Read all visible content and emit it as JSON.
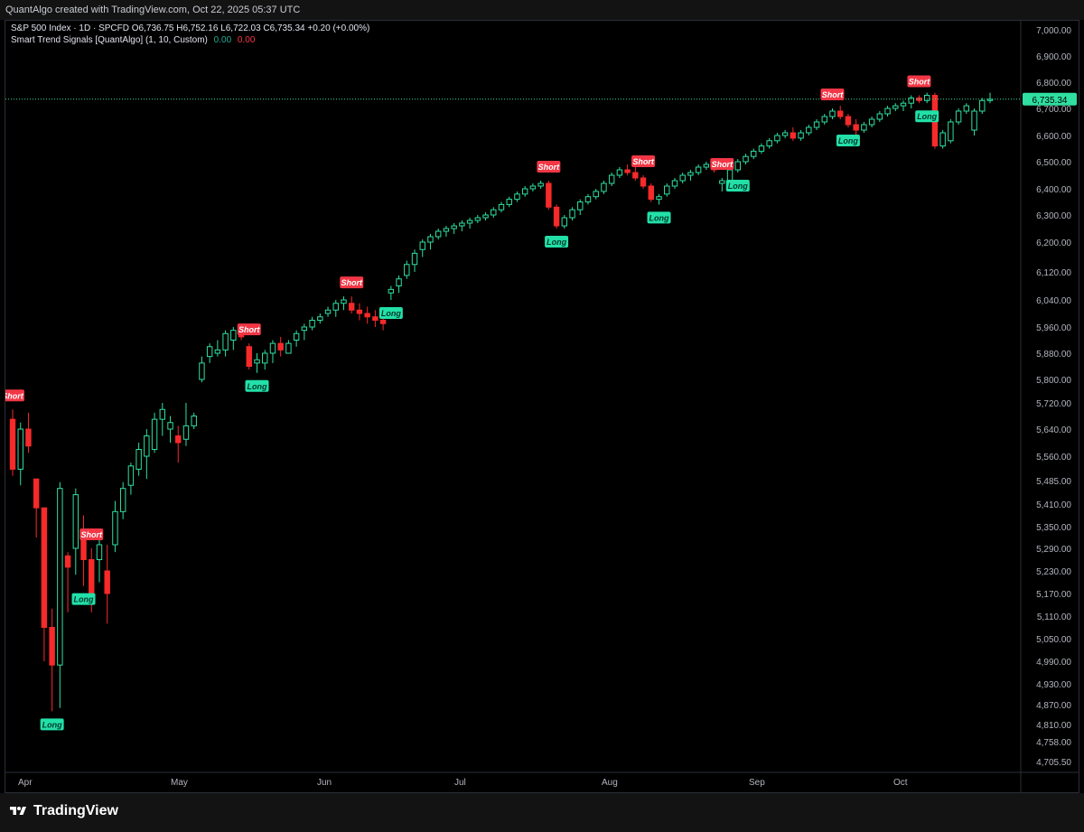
{
  "header": {
    "credit": "QuantAlgo created with TradingView.com, Oct 22, 2025 05:37 UTC"
  },
  "legend": {
    "symbol_line": "S&P 500 Index · 1D · SPCFD  O6,736.75  H6,752.16  L6,722.03  C6,735.34  +0.20 (+0.00%)",
    "indicator_name": "Smart Trend Signals [QuantAlgo] (1, 10, Custom)",
    "indicator_val1": "0.00",
    "indicator_val2": "0.00"
  },
  "footer": {
    "brand": "TradingView"
  },
  "colors": {
    "up": "#2fe0a0",
    "down": "#f72a2a",
    "short_label_bg": "#f23645",
    "long_label_bg": "#22e0a8",
    "grid": "#1e222d",
    "axis_text": "#b2b5be"
  },
  "chart_data": {
    "type": "candlestick",
    "title": "",
    "price_axis_ticks": [
      "7,000.00",
      "6,900.00",
      "6,800.00",
      "6,700.00",
      "6,600.00",
      "6,500.00",
      "6,400.00",
      "6,300.00",
      "6,200.00",
      "6,120.00",
      "6,040.00",
      "5,960.00",
      "5,880.00",
      "5,800.00",
      "5,720.00",
      "5,640.00",
      "5,560.00",
      "5,485.00",
      "5,410.00",
      "5,350.00",
      "5,290.00",
      "5,230.00",
      "5,170.00",
      "5,110.00",
      "5,050.00",
      "4,990.00",
      "4,930.00",
      "4,870.00",
      "4,810.00",
      "4,758.00",
      "4,705.50"
    ],
    "current_price_label": "6,735.34",
    "current_price": 6735.34,
    "time_axis_ticks": [
      "Apr",
      "May",
      "Jun",
      "Jul",
      "Aug",
      "Sep",
      "Oct"
    ],
    "candles": [
      [
        5670,
        5700,
        5500,
        5520
      ],
      [
        5520,
        5660,
        5470,
        5640
      ],
      [
        5640,
        5690,
        5570,
        5590
      ],
      [
        5490,
        5490,
        5320,
        5400
      ],
      [
        5400,
        5400,
        4990,
        5080
      ],
      [
        5080,
        5130,
        4850,
        4980
      ],
      [
        4980,
        5480,
        4860,
        5460
      ],
      [
        5270,
        5280,
        5120,
        5240
      ],
      [
        5290,
        5460,
        5220,
        5440
      ],
      [
        5320,
        5380,
        5190,
        5260
      ],
      [
        5260,
        5290,
        5120,
        5160
      ],
      [
        5260,
        5320,
        5200,
        5300
      ],
      [
        5230,
        5300,
        5090,
        5170
      ],
      [
        5300,
        5420,
        5280,
        5390
      ],
      [
        5390,
        5480,
        5370,
        5460
      ],
      [
        5470,
        5540,
        5440,
        5530
      ],
      [
        5520,
        5600,
        5500,
        5580
      ],
      [
        5560,
        5640,
        5490,
        5620
      ],
      [
        5580,
        5690,
        5570,
        5670
      ],
      [
        5670,
        5720,
        5620,
        5700
      ],
      [
        5640,
        5680,
        5600,
        5660
      ],
      [
        5620,
        5650,
        5540,
        5600
      ],
      [
        5610,
        5720,
        5590,
        5650
      ],
      [
        5650,
        5690,
        5640,
        5680
      ],
      [
        5800,
        5870,
        5790,
        5850
      ],
      [
        5870,
        5910,
        5850,
        5900
      ],
      [
        5880,
        5920,
        5870,
        5890
      ],
      [
        5890,
        5950,
        5870,
        5940
      ],
      [
        5920,
        5960,
        5890,
        5950
      ],
      [
        5950,
        5960,
        5920,
        5930
      ],
      [
        5900,
        5910,
        5830,
        5840
      ],
      [
        5850,
        5880,
        5820,
        5860
      ],
      [
        5850,
        5890,
        5830,
        5880
      ],
      [
        5880,
        5920,
        5850,
        5910
      ],
      [
        5910,
        5930,
        5870,
        5890
      ],
      [
        5880,
        5920,
        5880,
        5910
      ],
      [
        5920,
        5950,
        5900,
        5940
      ],
      [
        5950,
        5970,
        5920,
        5960
      ],
      [
        5960,
        5990,
        5950,
        5980
      ],
      [
        5980,
        6000,
        5970,
        5990
      ],
      [
        6000,
        6020,
        5990,
        6010
      ],
      [
        6010,
        6040,
        5990,
        6030
      ],
      [
        6030,
        6050,
        6010,
        6040
      ],
      [
        6030,
        6050,
        6000,
        6010
      ],
      [
        6010,
        6030,
        5980,
        6000
      ],
      [
        6000,
        6020,
        5970,
        5990
      ],
      [
        5990,
        6010,
        5960,
        5980
      ],
      [
        5980,
        6000,
        5950,
        5970
      ],
      [
        6060,
        6080,
        6040,
        6070
      ],
      [
        6080,
        6110,
        6060,
        6100
      ],
      [
        6110,
        6150,
        6100,
        6140
      ],
      [
        6140,
        6180,
        6120,
        6170
      ],
      [
        6180,
        6210,
        6160,
        6200
      ],
      [
        6200,
        6230,
        6180,
        6220
      ],
      [
        6220,
        6250,
        6210,
        6240
      ],
      [
        6240,
        6260,
        6220,
        6250
      ],
      [
        6250,
        6270,
        6230,
        6260
      ],
      [
        6260,
        6280,
        6240,
        6270
      ],
      [
        6270,
        6290,
        6250,
        6280
      ],
      [
        6280,
        6300,
        6270,
        6290
      ],
      [
        6290,
        6310,
        6280,
        6300
      ],
      [
        6300,
        6330,
        6290,
        6320
      ],
      [
        6320,
        6350,
        6310,
        6340
      ],
      [
        6340,
        6370,
        6330,
        6360
      ],
      [
        6360,
        6390,
        6350,
        6380
      ],
      [
        6380,
        6410,
        6370,
        6400
      ],
      [
        6400,
        6420,
        6390,
        6410
      ],
      [
        6410,
        6430,
        6400,
        6420
      ],
      [
        6420,
        6430,
        6320,
        6330
      ],
      [
        6330,
        6340,
        6250,
        6260
      ],
      [
        6260,
        6300,
        6250,
        6290
      ],
      [
        6290,
        6330,
        6280,
        6320
      ],
      [
        6320,
        6360,
        6300,
        6350
      ],
      [
        6350,
        6380,
        6340,
        6370
      ],
      [
        6370,
        6400,
        6360,
        6390
      ],
      [
        6390,
        6430,
        6380,
        6420
      ],
      [
        6420,
        6460,
        6410,
        6450
      ],
      [
        6450,
        6480,
        6440,
        6470
      ],
      [
        6470,
        6490,
        6450,
        6460
      ],
      [
        6460,
        6480,
        6430,
        6440
      ],
      [
        6440,
        6450,
        6400,
        6410
      ],
      [
        6410,
        6420,
        6350,
        6360
      ],
      [
        6360,
        6380,
        6340,
        6370
      ],
      [
        6380,
        6420,
        6370,
        6410
      ],
      [
        6410,
        6440,
        6400,
        6430
      ],
      [
        6430,
        6460,
        6420,
        6450
      ],
      [
        6450,
        6470,
        6430,
        6460
      ],
      [
        6460,
        6490,
        6450,
        6480
      ],
      [
        6480,
        6500,
        6470,
        6490
      ],
      [
        6490,
        6500,
        6460,
        6470
      ],
      [
        6420,
        6440,
        6390,
        6430
      ],
      [
        6430,
        6480,
        6420,
        6470
      ],
      [
        6470,
        6510,
        6460,
        6500
      ],
      [
        6500,
        6530,
        6490,
        6520
      ],
      [
        6520,
        6550,
        6510,
        6540
      ],
      [
        6540,
        6570,
        6530,
        6560
      ],
      [
        6560,
        6590,
        6550,
        6580
      ],
      [
        6580,
        6610,
        6570,
        6600
      ],
      [
        6600,
        6620,
        6590,
        6610
      ],
      [
        6610,
        6630,
        6580,
        6590
      ],
      [
        6590,
        6620,
        6580,
        6610
      ],
      [
        6610,
        6640,
        6600,
        6630
      ],
      [
        6630,
        6660,
        6620,
        6650
      ],
      [
        6650,
        6680,
        6640,
        6670
      ],
      [
        6670,
        6700,
        6660,
        6690
      ],
      [
        6690,
        6710,
        6660,
        6670
      ],
      [
        6670,
        6680,
        6630,
        6640
      ],
      [
        6640,
        6660,
        6600,
        6620
      ],
      [
        6620,
        6650,
        6610,
        6640
      ],
      [
        6640,
        6670,
        6630,
        6660
      ],
      [
        6660,
        6690,
        6650,
        6680
      ],
      [
        6680,
        6710,
        6670,
        6700
      ],
      [
        6700,
        6720,
        6690,
        6710
      ],
      [
        6710,
        6730,
        6690,
        6720
      ],
      [
        6720,
        6750,
        6700,
        6740
      ],
      [
        6740,
        6750,
        6720,
        6730
      ],
      [
        6730,
        6760,
        6720,
        6750
      ],
      [
        6750,
        6760,
        6550,
        6560
      ],
      [
        6560,
        6620,
        6550,
        6610
      ],
      [
        6580,
        6660,
        6570,
        6650
      ],
      [
        6650,
        6700,
        6640,
        6690
      ],
      [
        6690,
        6720,
        6680,
        6710
      ],
      [
        6620,
        6700,
        6600,
        6690
      ],
      [
        6690,
        6740,
        6680,
        6730
      ],
      [
        6730,
        6760,
        6720,
        6735
      ]
    ],
    "signals": [
      {
        "type": "short",
        "label": "Short",
        "index": 0
      },
      {
        "type": "long",
        "label": "Long",
        "index": 5
      },
      {
        "type": "long",
        "label": "Long",
        "index": 9
      },
      {
        "type": "short",
        "label": "Short",
        "index": 10
      },
      {
        "type": "short",
        "label": "Short",
        "index": 30
      },
      {
        "type": "long",
        "label": "Long",
        "index": 31
      },
      {
        "type": "short",
        "label": "Short",
        "index": 43
      },
      {
        "type": "long",
        "label": "Long",
        "index": 48
      },
      {
        "type": "short",
        "label": "Short",
        "index": 68
      },
      {
        "type": "long",
        "label": "Long",
        "index": 69
      },
      {
        "type": "short",
        "label": "Short",
        "index": 80
      },
      {
        "type": "long",
        "label": "Long",
        "index": 82
      },
      {
        "type": "short",
        "label": "Short",
        "index": 90
      },
      {
        "type": "long",
        "label": "Long",
        "index": 92
      },
      {
        "type": "short",
        "label": "Short",
        "index": 104
      },
      {
        "type": "long",
        "label": "Long",
        "index": 106
      },
      {
        "type": "short",
        "label": "Short",
        "index": 115
      },
      {
        "type": "long",
        "label": "Long",
        "index": 116
      }
    ]
  }
}
